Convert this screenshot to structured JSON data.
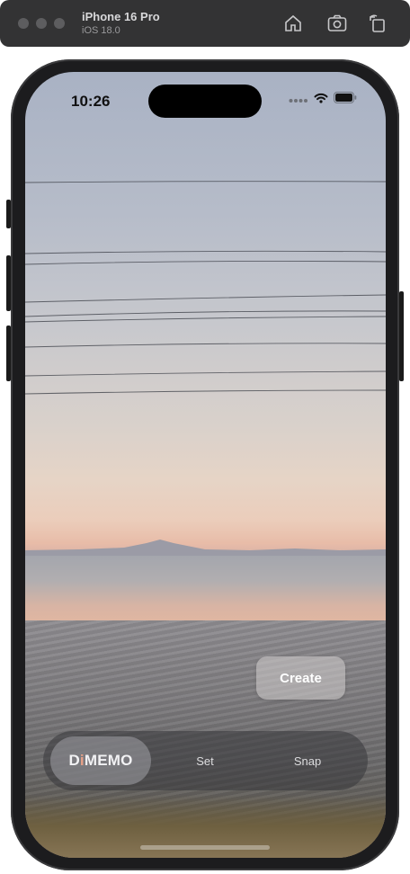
{
  "simulator": {
    "device_name": "iPhone 16 Pro",
    "os_version": "iOS 18.0",
    "toolbar_icons": [
      "home-icon",
      "screenshot-icon",
      "rotate-icon"
    ]
  },
  "status_bar": {
    "time": "10:26",
    "icons": [
      "cellular-dots-icon",
      "wifi-icon",
      "battery-icon"
    ]
  },
  "screen": {
    "background": "sunset-over-bay-photo",
    "create_button_label": "Create"
  },
  "tab_bar": {
    "brand": {
      "prefix": "D",
      "accent": "i",
      "suffix": "MEMO",
      "accent_color": "#e8a188"
    },
    "tabs": [
      {
        "label": "Set"
      },
      {
        "label": "Snap"
      }
    ]
  }
}
